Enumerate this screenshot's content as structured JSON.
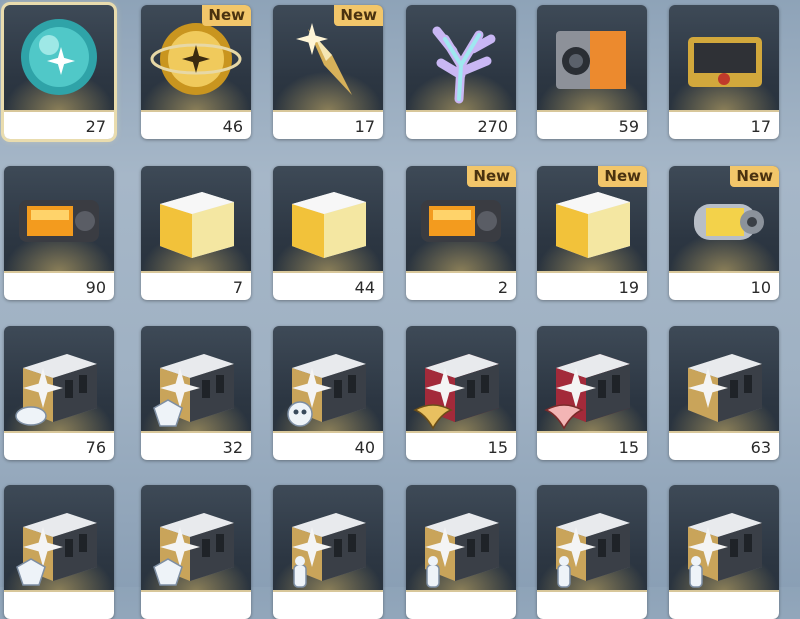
{
  "inventory": {
    "items": [
      {
        "count": "27",
        "badge": "",
        "icon": "cyan-star-orb-icon",
        "selected": true
      },
      {
        "count": "46",
        "badge": "New",
        "icon": "gold-star-orb-icon",
        "selected": false
      },
      {
        "count": "17",
        "badge": "New",
        "icon": "gold-star-shard-icon",
        "selected": false
      },
      {
        "count": "270",
        "badge": "",
        "icon": "prismatic-coral-icon",
        "selected": false
      },
      {
        "count": "59",
        "badge": "",
        "icon": "orange-supply-case-icon",
        "selected": false
      },
      {
        "count": "17",
        "badge": "",
        "icon": "gold-supply-case-icon",
        "selected": false
      },
      {
        "count": "90",
        "badge": "",
        "icon": "orange-battery-pack-icon",
        "selected": false
      },
      {
        "count": "7",
        "badge": "",
        "icon": "gold-crystal-crate-icon",
        "selected": false
      },
      {
        "count": "44",
        "badge": "",
        "icon": "gold-crystal-crate-icon",
        "selected": false
      },
      {
        "count": "2",
        "badge": "New",
        "icon": "orange-battery-pack-icon",
        "selected": false
      },
      {
        "count": "19",
        "badge": "New",
        "icon": "gold-crystal-crate-icon",
        "selected": false
      },
      {
        "count": "10",
        "badge": "New",
        "icon": "yellow-energy-capsule-icon",
        "selected": false
      },
      {
        "count": "76",
        "badge": "",
        "icon": "steel-star-crate-mask-icon",
        "selected": false
      },
      {
        "count": "32",
        "badge": "",
        "icon": "steel-star-crate-wolf-icon",
        "selected": false
      },
      {
        "count": "40",
        "badge": "",
        "icon": "steel-star-crate-owl-icon",
        "selected": false
      },
      {
        "count": "15",
        "badge": "",
        "icon": "red-star-crate-gold-emblem-icon",
        "selected": false
      },
      {
        "count": "15",
        "badge": "",
        "icon": "red-star-crate-pink-emblem-icon",
        "selected": false
      },
      {
        "count": "63",
        "badge": "",
        "icon": "steel-star-crate-icon",
        "selected": false
      },
      {
        "count": "",
        "badge": "",
        "icon": "steel-star-crate-wolf-icon",
        "selected": false
      },
      {
        "count": "",
        "badge": "",
        "icon": "steel-star-crate-wolf-icon",
        "selected": false
      },
      {
        "count": "",
        "badge": "",
        "icon": "steel-star-crate-figure-icon",
        "selected": false
      },
      {
        "count": "",
        "badge": "",
        "icon": "steel-star-crate-figure-icon",
        "selected": false
      },
      {
        "count": "",
        "badge": "",
        "icon": "steel-star-crate-figure-icon",
        "selected": false
      },
      {
        "count": "",
        "badge": "",
        "icon": "steel-star-crate-figure-icon",
        "selected": false
      }
    ]
  },
  "colors": {
    "badge_bg": "#f2c66a",
    "badge_text": "#4a3210",
    "selected_border": "#e9dcae",
    "cell_bg": "#2c3642",
    "count_bar": "#ffffff"
  }
}
